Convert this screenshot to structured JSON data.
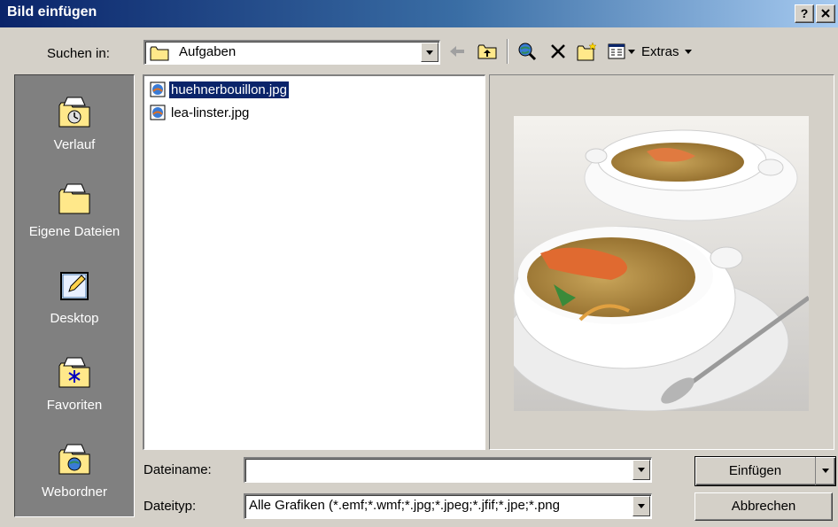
{
  "window": {
    "title": "Bild einfügen",
    "help_label": "?",
    "close_label": "X"
  },
  "lookin": {
    "label": "Suchen in:",
    "value": "Aufgaben"
  },
  "toolbar": {
    "extras_label": "Extras"
  },
  "places": [
    {
      "label": "Verlauf",
      "icon": "history-folder-icon"
    },
    {
      "label": "Eigene Dateien",
      "icon": "my-documents-folder-icon"
    },
    {
      "label": "Desktop",
      "icon": "desktop-icon"
    },
    {
      "label": "Favoriten",
      "icon": "favorites-folder-icon"
    },
    {
      "label": "Webordner",
      "icon": "web-folders-icon"
    }
  ],
  "files": [
    {
      "name": "huehnerbouillon.jpg",
      "selected": true
    },
    {
      "name": "lea-linster.jpg",
      "selected": false
    }
  ],
  "filename": {
    "label": "Dateiname:",
    "value": ""
  },
  "filetype": {
    "label": "Dateityp:",
    "value": "Alle Grafiken (*.emf;*.wmf;*.jpg;*.jpeg;*.jfif;*.jpe;*.png"
  },
  "buttons": {
    "insert": "Einfügen",
    "cancel": "Abbrechen"
  },
  "colors": {
    "selection": "#0a246a",
    "face": "#d4d0c8",
    "places_bg": "#808080"
  }
}
